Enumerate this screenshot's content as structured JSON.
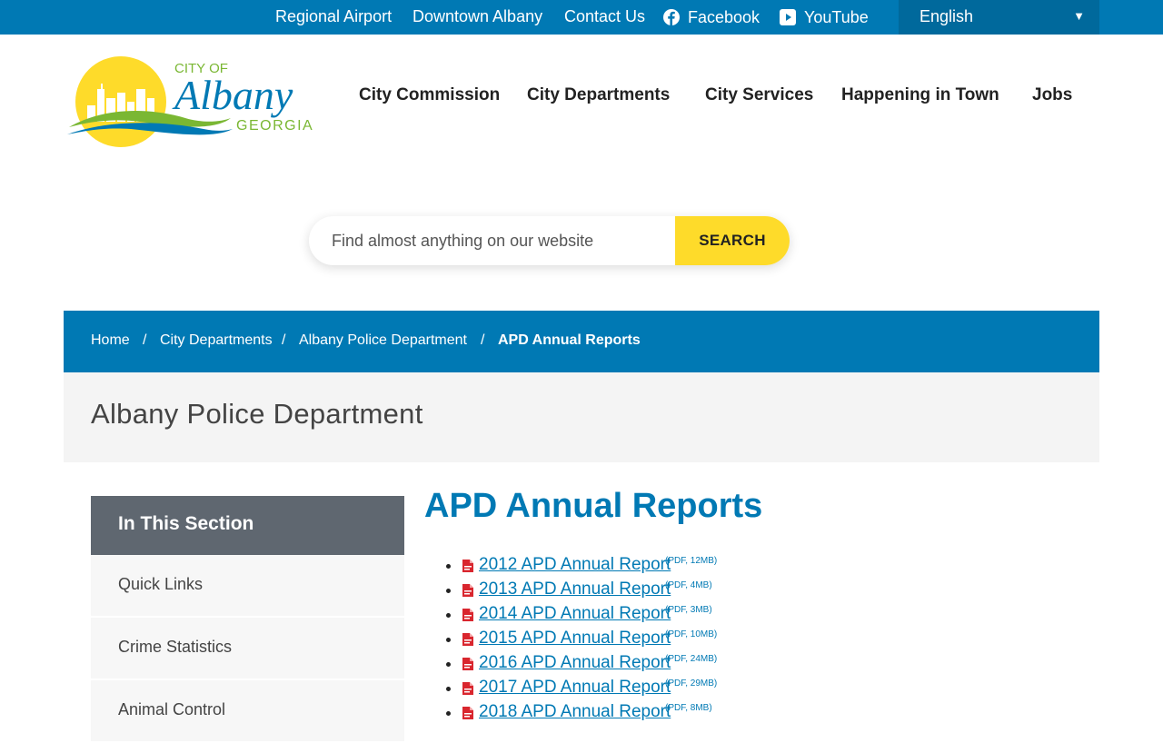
{
  "topbar": {
    "links": [
      "Regional Airport",
      "Downtown Albany",
      "Contact Us"
    ],
    "facebook": "Facebook",
    "youtube": "YouTube",
    "language": "English"
  },
  "logo": {
    "line1": "CITY OF",
    "line2": "Albany",
    "line3": "GEORGIA"
  },
  "nav": {
    "items": [
      "City Commission",
      "City Departments",
      "City Services",
      "Happening in Town",
      "Jobs"
    ]
  },
  "search": {
    "placeholder": "Find almost anything on our website",
    "button": "SEARCH"
  },
  "breadcrumb": {
    "items": [
      "Home",
      "City Departments",
      "Albany Police Department",
      "APD Annual Reports"
    ],
    "separator": "/"
  },
  "section_title": "Albany Police Department",
  "sidebar": {
    "heading": "In This Section",
    "items": [
      "Quick Links",
      "Crime Statistics",
      "Animal Control"
    ]
  },
  "content": {
    "title": "APD Annual Reports",
    "reports": [
      {
        "label": "2012 APD Annual Report",
        "meta": "(PDF, 12MB)"
      },
      {
        "label": "2013 APD Annual Report",
        "meta": "(PDF, 4MB)"
      },
      {
        "label": "2014 APD Annual Report",
        "meta": "(PDF, 3MB)"
      },
      {
        "label": "2015 APD Annual Report",
        "meta": "(PDF, 10MB)"
      },
      {
        "label": "2016 APD Annual Report",
        "meta": "(PDF, 24MB)"
      },
      {
        "label": "2017 APD Annual Report",
        "meta": "(PDF, 29MB)"
      },
      {
        "label": "2018 APD Annual Report",
        "meta": "(PDF, 8MB)"
      }
    ]
  },
  "colors": {
    "brand_blue": "#0079b4",
    "accent_yellow": "#fedb2a",
    "sidebar_head": "#5f6770"
  }
}
